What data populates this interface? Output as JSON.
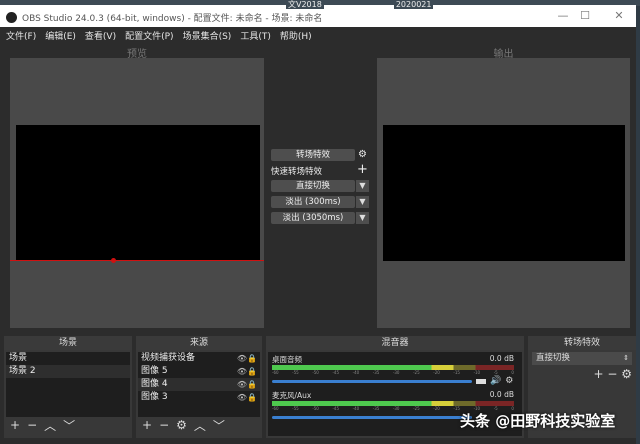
{
  "desktop_text": [
    "文V2018",
    "2020021"
  ],
  "window": {
    "title": "OBS Studio 24.0.3 (64-bit, windows) - 配置文件: 未命名 - 场景: 未命名",
    "min": "—",
    "max": "☐",
    "close": "✕"
  },
  "menu": [
    "文件(F)",
    "编辑(E)",
    "查看(V)",
    "配置文件(P)",
    "场景集合(S)",
    "工具(T)",
    "帮助(H)"
  ],
  "preview": {
    "label": "预览"
  },
  "output": {
    "label": "输出"
  },
  "transition_controls": {
    "transition_button": "转场特效",
    "quick_label": "快速转场特效",
    "items": [
      "直接切换",
      "淡出 (300ms)",
      "淡出 (3050ms)"
    ]
  },
  "scenes": {
    "title": "场景",
    "items": [
      "场景",
      "场景 2"
    ]
  },
  "sources": {
    "title": "来源",
    "items": [
      "视频捕获设备",
      "图像 5",
      "图像 4",
      "图像 3"
    ]
  },
  "mixer": {
    "title": "混音器",
    "channels": [
      {
        "name": "桌面音频",
        "db": "0.0 dB",
        "volume": 0.92
      },
      {
        "name": "麦克风/Aux",
        "db": "0.0 dB",
        "volume": 0.92
      }
    ],
    "ticks": [
      "-60",
      "-55",
      "-50",
      "-45",
      "-40",
      "-35",
      "-30",
      "-25",
      "-20",
      "-15",
      "-10",
      "-5",
      "0"
    ]
  },
  "transitions_dock": {
    "title": "转场特效",
    "selected": "直接切换"
  },
  "watermark": "头条 @田野科技实验室",
  "colors": {
    "accent": "#3a7fd0",
    "meter_green": "#4ec94e",
    "meter_yellow": "#d6cf3a",
    "meter_red": "#b33a3a",
    "guide": "#d01010"
  }
}
